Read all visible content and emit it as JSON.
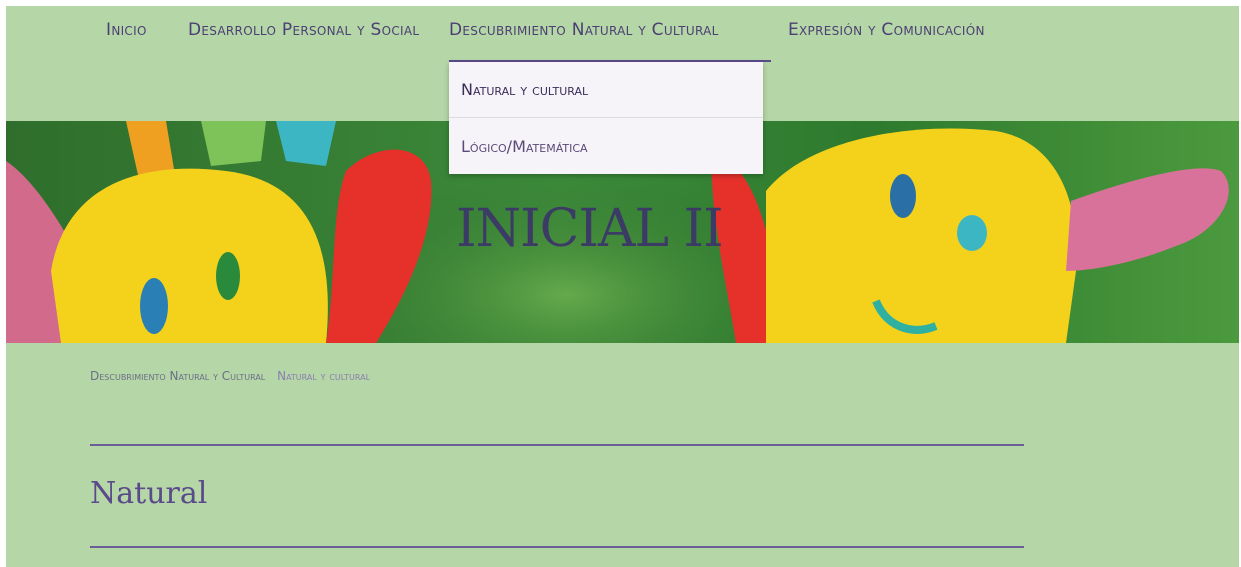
{
  "nav": {
    "items": [
      {
        "label": "Inicio"
      },
      {
        "label": "Desarrollo Personal y Social"
      },
      {
        "label": "Descubrimiento Natural y Cultural"
      },
      {
        "label": "Expresión y Comunicación"
      }
    ],
    "active_index": 2
  },
  "dropdown": {
    "items": [
      {
        "label": "Natural y cultural"
      },
      {
        "label": "Lógico/Matemática"
      }
    ]
  },
  "banner": {
    "title": "INICIAL II"
  },
  "breadcrumb": {
    "parent": "Descubrimiento Natural y Cultural",
    "current": "Natural y cultural"
  },
  "page": {
    "title": "Natural"
  },
  "colors": {
    "background": "#b5d6a7",
    "accent": "#5a4a8a",
    "nav_text": "#4c3f73"
  }
}
